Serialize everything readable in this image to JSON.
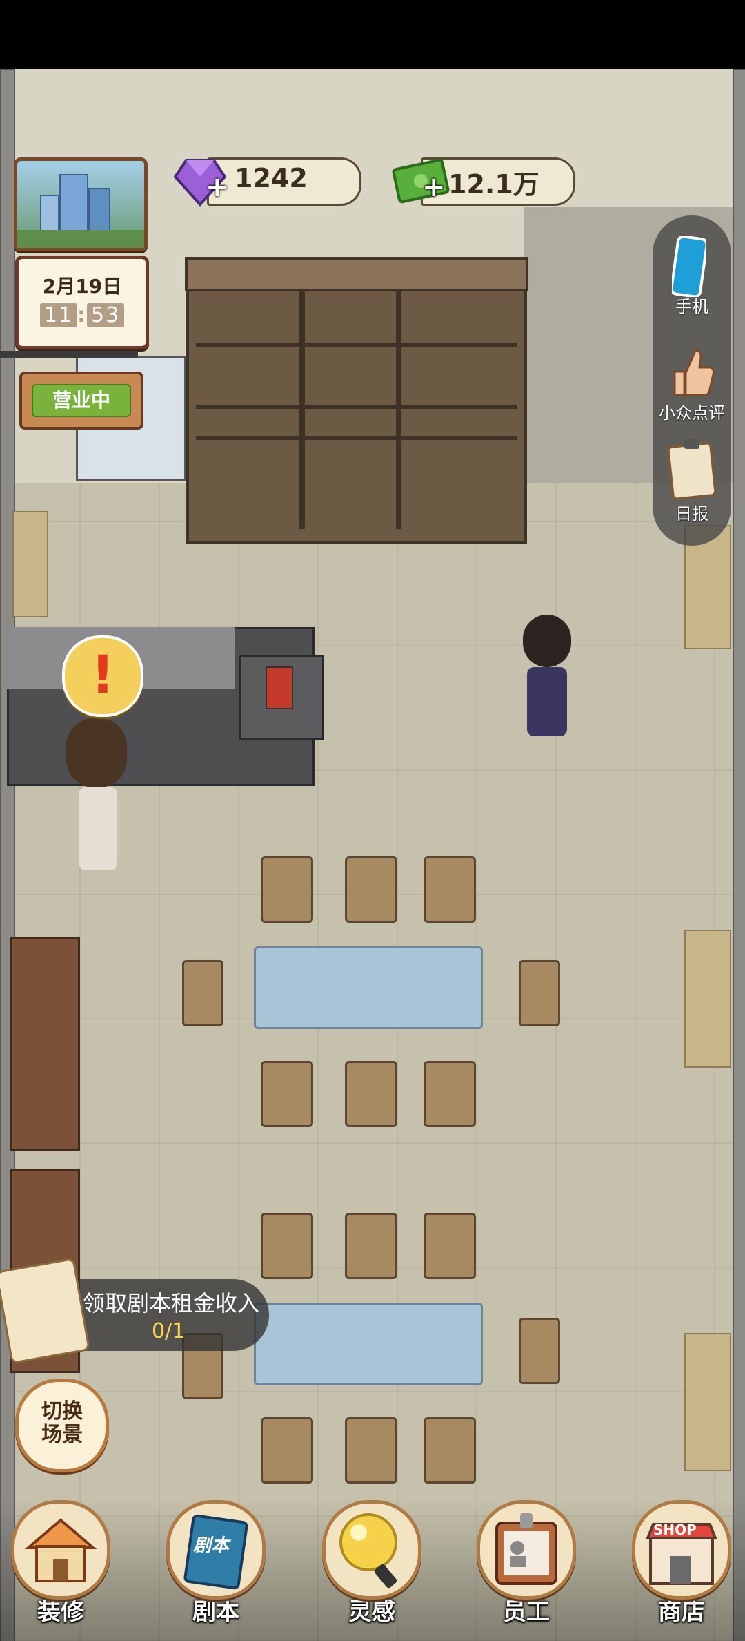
{
  "hud": {
    "gems": "1242",
    "cash": "12.1万",
    "plus": "+",
    "calendar": {
      "date": "2月19日",
      "hour": "11",
      "minute": "53",
      "separator": ":"
    },
    "open_status": "营业中"
  },
  "side_menu": [
    {
      "label": "手机",
      "icon": "phone-icon"
    },
    {
      "label": "小众点评",
      "icon": "thumbs-up-icon"
    },
    {
      "label": "日报",
      "icon": "clipboard-icon"
    }
  ],
  "alert": {
    "mark": "!"
  },
  "task": {
    "title": "领取剧本租金收入",
    "progress": "0/1"
  },
  "switch_scene": {
    "line1": "切换",
    "line2": "场景"
  },
  "bottom_nav": [
    {
      "label": "装修",
      "icon": "house-icon"
    },
    {
      "label": "剧本",
      "icon": "script-book-icon",
      "badge": "剧本"
    },
    {
      "label": "灵感",
      "icon": "lightbulb-icon"
    },
    {
      "label": "员工",
      "icon": "id-badge-icon"
    },
    {
      "label": "商店",
      "icon": "shop-icon",
      "badge": "SHOP"
    }
  ],
  "colors": {
    "gem": "#9b5fd6",
    "cash": "#58b03a",
    "open_sign": "#7ab33b",
    "alert": "#e23a1e"
  }
}
